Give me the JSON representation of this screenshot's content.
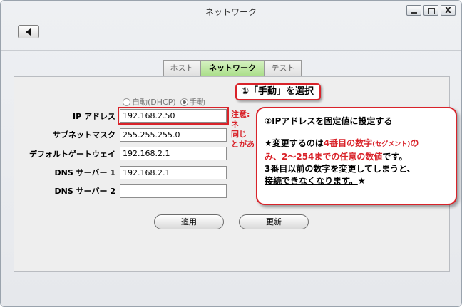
{
  "window": {
    "title": "ネットワーク",
    "controls": {
      "close": "X"
    }
  },
  "tabs": [
    "ホスト",
    "ネットワーク",
    "テスト"
  ],
  "mode": {
    "auto_label": "自動(DHCP)",
    "manual_label": "手動",
    "selected": "manual"
  },
  "form": {
    "ip_label": "IP アドレス",
    "ip_value": "192.168.2.50",
    "mask_label": "サブネットマスク",
    "mask_value": "255.255.255.0",
    "gateway_label": "デフォルトゲートウェイ",
    "gateway_value": "192.168.2.1",
    "dns1_label": "DNS サーバー 1",
    "dns1_value": "192.168.2.1",
    "dns2_label": "DNS サーバー 2",
    "dns2_value": ""
  },
  "note": {
    "title": "注意:",
    "line1": "ネ",
    "line2": "同じ",
    "line3": "とがあ"
  },
  "buttons": {
    "apply": "適用",
    "update": "更新"
  },
  "callouts": {
    "step1": "①「手動」を選択",
    "step2_title": "②IPアドレスを固定値に設定する",
    "step2_l1a": "★変更するのは",
    "step2_l1b": "4番目の数字",
    "step2_l1c": "(セグメント)",
    "step2_l1d": "の",
    "step2_l2a": "み、2～254までの任意の数値",
    "step2_l2b": "です。",
    "step2_l3": "3番目以前の数字を変更してしまうと、",
    "step2_l4": "接続できなくなります。",
    "step2_l4b": "★"
  },
  "colors": {
    "accent_red": "#d9232a",
    "tab_active": "#a8dd86"
  }
}
